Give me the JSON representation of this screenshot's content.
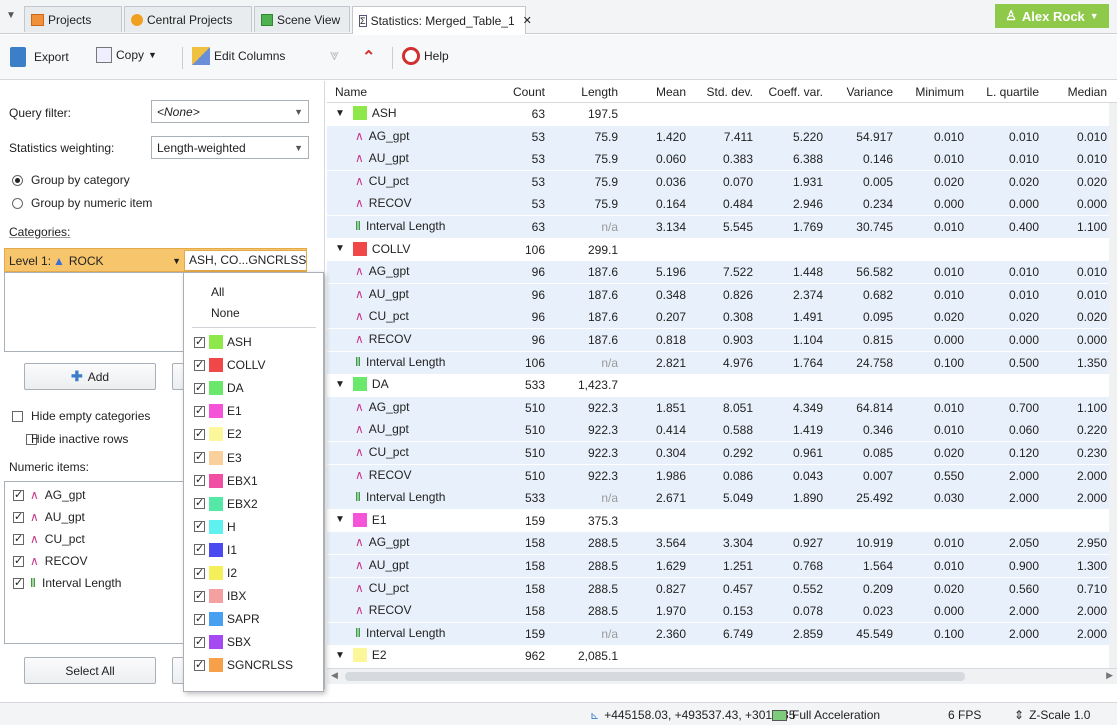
{
  "tabs": [
    {
      "label": "Projects",
      "icon": "projects-icon"
    },
    {
      "label": "Central Projects",
      "icon": "central-projects-icon"
    },
    {
      "label": "Scene View",
      "icon": "scene-view-icon"
    },
    {
      "label": "Statistics: Merged_Table_1",
      "icon": "statistics-icon",
      "active": true
    }
  ],
  "user": {
    "name": "Alex Rock",
    "color": "#8ec94a"
  },
  "toolbar": {
    "export_label": "Export",
    "copy_label": "Copy",
    "edit_columns_label": "Edit Columns",
    "help_label": "Help"
  },
  "left": {
    "query_filter_label": "Query filter:",
    "query_filter_value": "<None>",
    "weighting_label": "Statistics weighting:",
    "weighting_value": "Length-weighted",
    "group_category_label": "Group by category",
    "group_numeric_label": "Group by numeric item",
    "categories_label": "Categories:",
    "level_label": "Level 1:",
    "level_column": "ROCK",
    "level_selection": "ASH, CO...GNCRLSS",
    "add_label": "Add",
    "hide_empty_label": "Hide empty categories",
    "hide_inactive_label": "Hide inactive rows",
    "numeric_items_label": "Numeric items:",
    "numeric_items": [
      "AG_gpt",
      "AU_gpt",
      "CU_pct",
      "RECOV",
      "Interval Length"
    ],
    "select_all_label": "Select All"
  },
  "dropdown": {
    "all_label": "All",
    "none_label": "None",
    "items": [
      {
        "label": "ASH",
        "color": "#8ee84a"
      },
      {
        "label": "COLLV",
        "color": "#f04848"
      },
      {
        "label": "DA",
        "color": "#6be86b"
      },
      {
        "label": "E1",
        "color": "#f553d8"
      },
      {
        "label": "E2",
        "color": "#fbf79a"
      },
      {
        "label": "E3",
        "color": "#f9cf9c"
      },
      {
        "label": "EBX1",
        "color": "#f04fa3"
      },
      {
        "label": "EBX2",
        "color": "#55e8a6"
      },
      {
        "label": "H",
        "color": "#5ff0f0"
      },
      {
        "label": "I1",
        "color": "#4a4af0"
      },
      {
        "label": "I2",
        "color": "#f4f05a"
      },
      {
        "label": "IBX",
        "color": "#f4a0a0"
      },
      {
        "label": "SAPR",
        "color": "#4aa0f0"
      },
      {
        "label": "SBX",
        "color": "#a54af0"
      },
      {
        "label": "SGNCRLSS",
        "color": "#f7a04a"
      }
    ]
  },
  "table": {
    "columns": [
      "Name",
      "Count",
      "Length",
      "Mean",
      "Std. dev.",
      "Coeff. var.",
      "Variance",
      "Minimum",
      "L. quartile",
      "Median"
    ],
    "rows": [
      {
        "type": "group",
        "name": "ASH",
        "color": "#8ee84a",
        "count": "63",
        "length": "197.5"
      },
      {
        "type": "item",
        "name": "AG_gpt",
        "v": [
          "53",
          "75.9",
          "1.420",
          "7.411",
          "5.220",
          "54.917",
          "0.010",
          "0.010",
          "0.010"
        ]
      },
      {
        "type": "item",
        "name": "AU_gpt",
        "v": [
          "53",
          "75.9",
          "0.060",
          "0.383",
          "6.388",
          "0.146",
          "0.010",
          "0.010",
          "0.010"
        ]
      },
      {
        "type": "item",
        "name": "CU_pct",
        "v": [
          "53",
          "75.9",
          "0.036",
          "0.070",
          "1.931",
          "0.005",
          "0.020",
          "0.020",
          "0.020"
        ]
      },
      {
        "type": "item",
        "name": "RECOV",
        "v": [
          "53",
          "75.9",
          "0.164",
          "0.484",
          "2.946",
          "0.234",
          "0.000",
          "0.000",
          "0.000"
        ]
      },
      {
        "type": "interval",
        "name": "Interval Length",
        "v": [
          "63",
          "n/a",
          "3.134",
          "5.545",
          "1.769",
          "30.745",
          "0.010",
          "0.400",
          "1.100"
        ]
      },
      {
        "type": "group",
        "name": "COLLV",
        "color": "#f04848",
        "count": "106",
        "length": "299.1"
      },
      {
        "type": "item",
        "name": "AG_gpt",
        "v": [
          "96",
          "187.6",
          "5.196",
          "7.522",
          "1.448",
          "56.582",
          "0.010",
          "0.010",
          "0.010"
        ]
      },
      {
        "type": "item",
        "name": "AU_gpt",
        "v": [
          "96",
          "187.6",
          "0.348",
          "0.826",
          "2.374",
          "0.682",
          "0.010",
          "0.010",
          "0.010"
        ]
      },
      {
        "type": "item",
        "name": "CU_pct",
        "v": [
          "96",
          "187.6",
          "0.207",
          "0.308",
          "1.491",
          "0.095",
          "0.020",
          "0.020",
          "0.020"
        ]
      },
      {
        "type": "item",
        "name": "RECOV",
        "v": [
          "96",
          "187.6",
          "0.818",
          "0.903",
          "1.104",
          "0.815",
          "0.000",
          "0.000",
          "0.000"
        ]
      },
      {
        "type": "interval",
        "name": "Interval Length",
        "v": [
          "106",
          "n/a",
          "2.821",
          "4.976",
          "1.764",
          "24.758",
          "0.100",
          "0.500",
          "1.350"
        ]
      },
      {
        "type": "group",
        "name": "DA",
        "color": "#6be86b",
        "count": "533",
        "length": "1,423.7"
      },
      {
        "type": "item",
        "name": "AG_gpt",
        "v": [
          "510",
          "922.3",
          "1.851",
          "8.051",
          "4.349",
          "64.814",
          "0.010",
          "0.700",
          "1.100"
        ]
      },
      {
        "type": "item",
        "name": "AU_gpt",
        "v": [
          "510",
          "922.3",
          "0.414",
          "0.588",
          "1.419",
          "0.346",
          "0.010",
          "0.060",
          "0.220"
        ]
      },
      {
        "type": "item",
        "name": "CU_pct",
        "v": [
          "510",
          "922.3",
          "0.304",
          "0.292",
          "0.961",
          "0.085",
          "0.020",
          "0.120",
          "0.230"
        ]
      },
      {
        "type": "item",
        "name": "RECOV",
        "v": [
          "510",
          "922.3",
          "1.986",
          "0.086",
          "0.043",
          "0.007",
          "0.550",
          "2.000",
          "2.000"
        ]
      },
      {
        "type": "interval",
        "name": "Interval Length",
        "v": [
          "533",
          "n/a",
          "2.671",
          "5.049",
          "1.890",
          "25.492",
          "0.030",
          "2.000",
          "2.000"
        ]
      },
      {
        "type": "group",
        "name": "E1",
        "color": "#f553d8",
        "count": "159",
        "length": "375.3"
      },
      {
        "type": "item",
        "name": "AG_gpt",
        "v": [
          "158",
          "288.5",
          "3.564",
          "3.304",
          "0.927",
          "10.919",
          "0.010",
          "2.050",
          "2.950"
        ]
      },
      {
        "type": "item",
        "name": "AU_gpt",
        "v": [
          "158",
          "288.5",
          "1.629",
          "1.251",
          "0.768",
          "1.564",
          "0.010",
          "0.900",
          "1.300"
        ]
      },
      {
        "type": "item",
        "name": "CU_pct",
        "v": [
          "158",
          "288.5",
          "0.827",
          "0.457",
          "0.552",
          "0.209",
          "0.020",
          "0.560",
          "0.710"
        ]
      },
      {
        "type": "item",
        "name": "RECOV",
        "v": [
          "158",
          "288.5",
          "1.970",
          "0.153",
          "0.078",
          "0.023",
          "0.000",
          "2.000",
          "2.000"
        ]
      },
      {
        "type": "interval",
        "name": "Interval Length",
        "v": [
          "159",
          "n/a",
          "2.360",
          "6.749",
          "2.859",
          "45.549",
          "0.100",
          "2.000",
          "2.000"
        ]
      },
      {
        "type": "group",
        "name": "E2",
        "color": "#fbf79a",
        "count": "962",
        "length": "2,085.1"
      }
    ]
  },
  "status": {
    "coords": "+445158.03, +493537.43, +3014.35",
    "acceleration": "Full Acceleration",
    "fps": "6 FPS",
    "zscale": "Z-Scale 1.0"
  }
}
